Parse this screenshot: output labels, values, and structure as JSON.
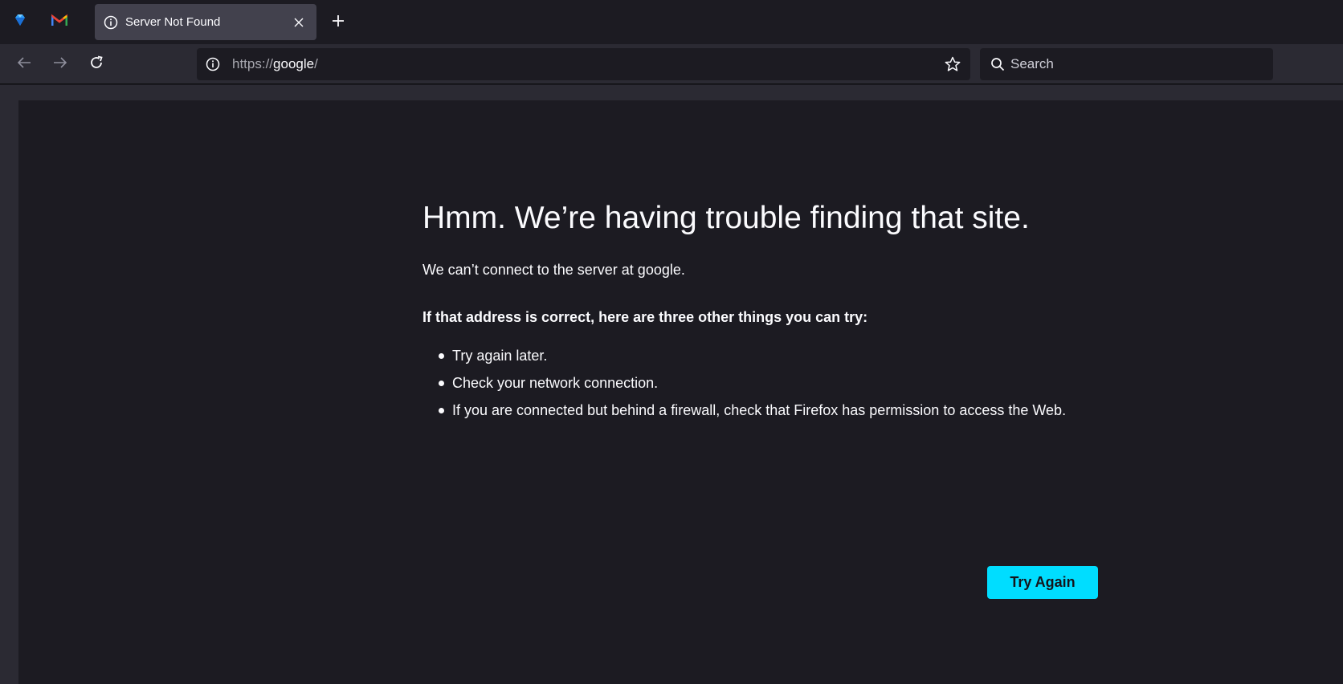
{
  "tabs": [
    {
      "title": "Server Not Found",
      "active": true
    }
  ],
  "pinned_tabs": [
    "gem-icon",
    "gmail-icon"
  ],
  "urlbar": {
    "scheme": "https://",
    "host": "google",
    "path": "/"
  },
  "search": {
    "placeholder": "Search"
  },
  "error_page": {
    "title": "Hmm. We’re having trouble finding that site.",
    "description": "We can’t connect to the server at google.",
    "subheading": "If that address is correct, here are three other things you can try:",
    "suggestions": [
      "Try again later.",
      "Check your network connection.",
      "If you are connected but behind a firewall, check that Firefox has permission to access the Web."
    ],
    "button_label": "Try Again"
  },
  "colors": {
    "accent": "#00ddff",
    "background": "#1c1b22",
    "toolbar": "#2b2a33",
    "active_tab": "#42414d"
  }
}
